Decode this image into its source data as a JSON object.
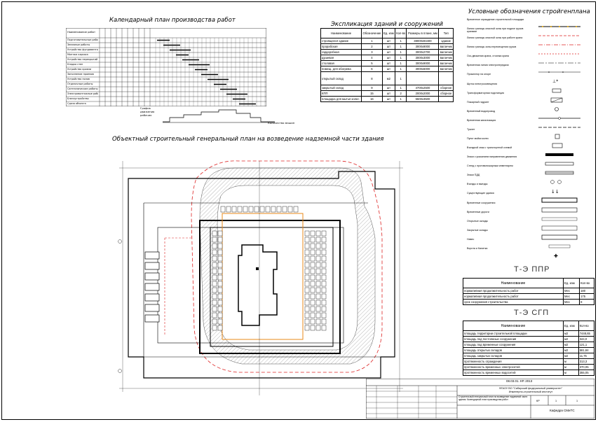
{
  "titles": {
    "calendar": "Календарный план производства работ",
    "explication": "Экспликация зданий и сооружений",
    "legend": "Условные обозначения стройгенплана",
    "plan": "Объектный строительный генеральный план на возведение надземной части здания"
  },
  "calendar": {
    "header": "Наименование работ",
    "rows": [
      "Подготовительные работы",
      "Земляные работы",
      "Устройство фундаментов",
      "Монтаж каркаса",
      "Устройство перекрытий",
      "Кладка стен",
      "Устройство кровли",
      "Заполнение проемов",
      "Устройство полов",
      "Отделочные работы",
      "Сантехнические работы",
      "Электромонтажные работы",
      "Благоустройство",
      "Сдача объекта"
    ],
    "chart_caption": "График движения рабочих",
    "machines_caption": "Количество машин"
  },
  "explication": {
    "headers": [
      "Наименование",
      "Обозначение",
      "Ед. изм",
      "Кол-во",
      "Размеры в плане, мм",
      "Тип"
    ],
    "rows": [
      {
        "name": "строящееся здание",
        "sym": "1",
        "unit": "шт",
        "qty": "1",
        "size": "38000х94400",
        "type": "здание"
      },
      {
        "name": "прорабская",
        "sym": "2",
        "unit": "шт",
        "qty": "1",
        "size": "3000х9000",
        "type": "вагончик"
      },
      {
        "name": "гардеробная",
        "sym": "3",
        "unit": "шт",
        "qty": "1",
        "size": "3000х2700",
        "type": "вагончик"
      },
      {
        "name": "душевая",
        "sym": "4",
        "unit": "шт",
        "qty": "1",
        "size": "3000х3000",
        "type": "вагончик"
      },
      {
        "name": "столовая",
        "sym": "5",
        "unit": "шт",
        "qty": "1",
        "size": "3000х9000",
        "type": "вагончик"
      },
      {
        "name": "помещ. для обогрева",
        "sym": "6",
        "unit": "шт",
        "qty": "1",
        "size": "3000х6000",
        "type": "вагончик"
      },
      {
        "name": "открытый склад",
        "sym": "8",
        "unit": "м2",
        "qty": "1",
        "size": "",
        "type": ""
      },
      {
        "name": "закрытый склад",
        "sym": "9",
        "unit": "шт",
        "qty": "1",
        "size": "4700х2500",
        "type": "сборное"
      },
      {
        "name": "КПП",
        "sym": "15",
        "unit": "шт",
        "qty": "2",
        "size": "2000х2000",
        "type": "сборное"
      },
      {
        "name": "площадка для мытья колес",
        "sym": "16",
        "unit": "шт",
        "qty": "1",
        "size": "5500х3500",
        "type": ""
      }
    ]
  },
  "legend": {
    "items": [
      "Временное ограждение строительной площадки",
      "Линия границы опасной зоны при подаче грузов кранами",
      "Линия границы опасной зоны при работе крана",
      "Линия границы зоны перемещения грузов",
      "Ось движения крана, стоянка крана",
      "Временная линия электропередачи",
      "Прожектор на опоре",
      "Щиток электроосвещения",
      "Трансформаторная подстанция",
      "Пожарный гидрант",
      "Временный водопровод",
      "Временная канализация",
      "Туалет",
      "Пункт мойки колес",
      "Въездной знак с транспортной схемой",
      "Знаки с указанием направления движения",
      "Стенд с противопожарным инвентарем",
      "Знаки ПДД",
      "Въезды и выезды",
      "Существующие здания",
      "Временные сооружения",
      "Временные дороги",
      "Открытые склады",
      "Закрытые склады",
      "Навес",
      "Ворота и Калитка"
    ]
  },
  "tep1": {
    "label": "Т-Э ППР",
    "header_name": "Наименование",
    "header_unit": "Ед. изм",
    "header_qty": "Кол-во",
    "rows": [
      {
        "name": "нормативная продолжительность работ",
        "unit": "Мес",
        "qty": "180"
      },
      {
        "name": "нормативная продолжительность работ",
        "unit": "Мес",
        "qty": "175"
      },
      {
        "name": "срок сооружения строительства",
        "unit": "Мес",
        "qty": "8"
      }
    ]
  },
  "tep2": {
    "label": "Т-Э СГП",
    "header_name": "Наименование",
    "header_unit": "Ед. изм",
    "header_qty": "Кол-во",
    "rows": [
      {
        "name": "площадь территории строительной площадки",
        "unit": "м2",
        "qty": "7448,65"
      },
      {
        "name": "площадь под постоянные сооружения",
        "unit": "м2",
        "qty": "344,0"
      },
      {
        "name": "площадь под временные сооружения",
        "unit": "м2",
        "qty": "121,1"
      },
      {
        "name": "площадь открытых складов",
        "unit": "м2",
        "qty": "581,84"
      },
      {
        "name": "площадь закрытых складов",
        "unit": "м2",
        "qty": "11,75"
      },
      {
        "name": "протяженность ограждения",
        "unit": "м",
        "qty": "313,3"
      },
      {
        "name": "протяженность временных электросетей",
        "unit": "м",
        "qty": "370,05"
      },
      {
        "name": "протяженность временных водосетей",
        "unit": "м",
        "qty": "355,05"
      }
    ]
  },
  "stamp": {
    "code": "08.03.01. КР. 2013",
    "org": "ФГАОУ ВО \"Сибирский федеральный университет\"",
    "institute": "Инженерно-строительный институт",
    "description": "Строительный генеральный план на возведение надземной части здания. Календарный план производства работ",
    "stage": "КР",
    "sheet": "1",
    "sheets": "1",
    "dept": "Кафедра СМиТС"
  }
}
